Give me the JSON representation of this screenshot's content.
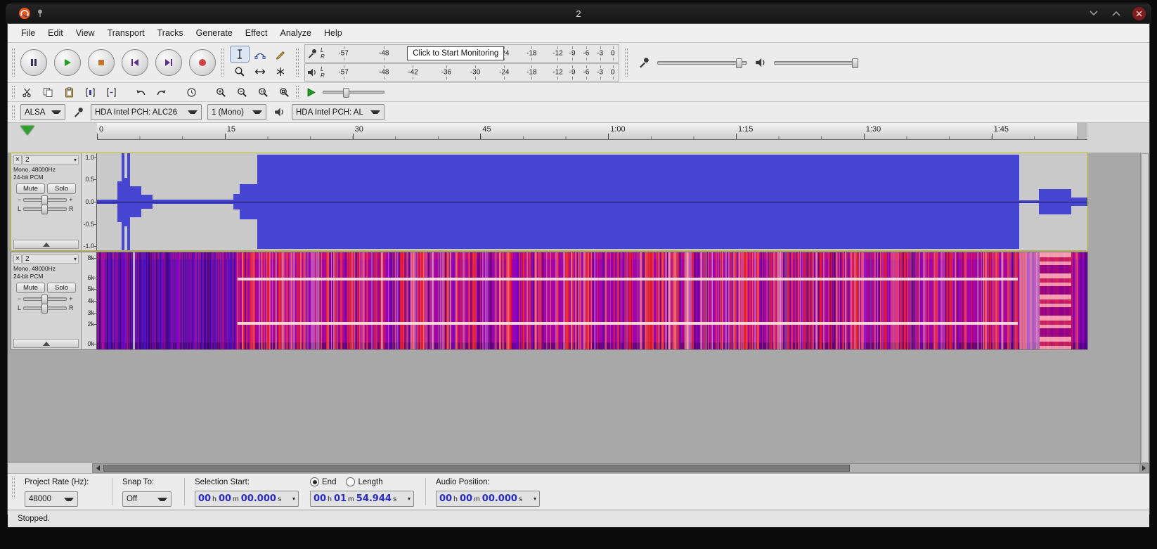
{
  "window": {
    "title": "2"
  },
  "menubar": {
    "items": [
      "File",
      "Edit",
      "View",
      "Transport",
      "Tracks",
      "Generate",
      "Effect",
      "Analyze",
      "Help"
    ]
  },
  "meters": {
    "scale": [
      "-57",
      "-48",
      "-42",
      "-36",
      "-30",
      "-24",
      "-18",
      "-12",
      "-9",
      "-6",
      "-3",
      "0"
    ],
    "left": "L",
    "right": "R",
    "monitor_text": "Click to Start Monitoring"
  },
  "device_toolbar": {
    "host": "ALSA",
    "recording_device": "HDA Intel PCH: ALC26",
    "channels": "1 (Mono)",
    "playback_device": "HDA Intel PCH: AL"
  },
  "timeline": {
    "labels": [
      "0",
      "15",
      "30",
      "45",
      "1:00",
      "1:15",
      "1:30",
      "1:45"
    ]
  },
  "tracks": [
    {
      "name": "2",
      "format": "Mono, 48000Hz",
      "depth": "24-bit PCM",
      "mute": "Mute",
      "solo": "Solo",
      "ruler": [
        "1.0",
        "0.5",
        "0.0",
        "-0.5",
        "-1.0"
      ]
    },
    {
      "name": "2",
      "format": "Mono, 48000Hz",
      "depth": "24-bit PCM",
      "mute": "Mute",
      "solo": "Solo",
      "ruler": [
        "8k",
        "6k",
        "5k",
        "4k",
        "3k",
        "2k",
        "0k"
      ]
    }
  ],
  "waveform": {
    "color": "#4646d2",
    "segments": [
      [
        0,
        2.06,
        0.04
      ],
      [
        2.06,
        2.48,
        0.42
      ],
      [
        2.48,
        2.77,
        1.0
      ],
      [
        2.77,
        3.05,
        0.5
      ],
      [
        3.05,
        3.34,
        1.0
      ],
      [
        3.34,
        4.5,
        0.32
      ],
      [
        4.5,
        5.6,
        0.14
      ],
      [
        5.6,
        13.8,
        0.05
      ],
      [
        13.8,
        14.4,
        0.16
      ],
      [
        14.4,
        16.2,
        0.36
      ],
      [
        16.2,
        93.1,
        0.97
      ],
      [
        93.1,
        95.1,
        0.035
      ],
      [
        95.1,
        98.35,
        0.26
      ],
      [
        98.35,
        100,
        0.08
      ]
    ]
  },
  "spectrogram": {
    "base_color": "#a005a5"
  },
  "selection_toolbar": {
    "project_rate_label": "Project Rate (Hz):",
    "project_rate": "48000",
    "snap_label": "Snap To:",
    "snap": "Off",
    "sel_start_label": "Selection Start:",
    "end_label": "End",
    "length_label": "Length",
    "audio_pos_label": "Audio Position:",
    "units": {
      "h": "h",
      "m": "m",
      "s": "s"
    },
    "sel_start": {
      "h": "00",
      "m": "00",
      "s": "00.000"
    },
    "sel_end": {
      "h": "00",
      "m": "01",
      "s": "54.944"
    },
    "audio_pos": {
      "h": "00",
      "m": "00",
      "s": "00.000"
    }
  },
  "statusbar": {
    "text": "Stopped."
  },
  "glyphs": {
    "close": "×",
    "dropdown": "▾",
    "minus": "−",
    "plus": "+",
    "pan_l": "L",
    "pan_r": "R"
  }
}
